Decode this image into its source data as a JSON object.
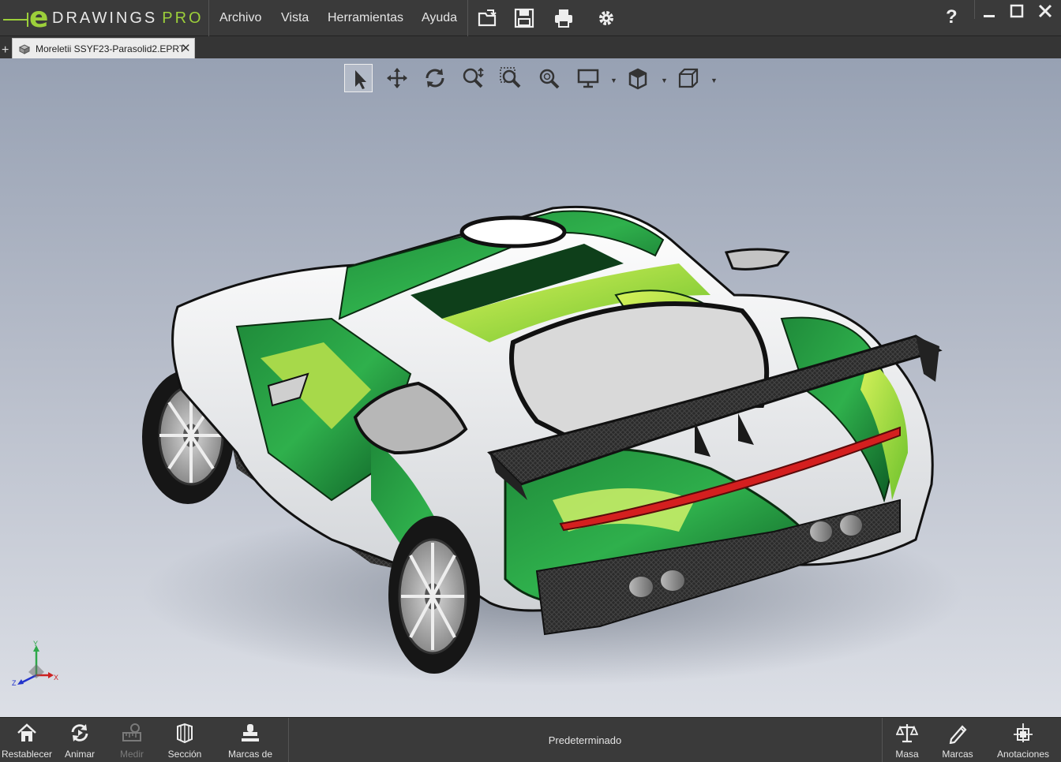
{
  "app": {
    "brand": "DRAWINGS",
    "brand_edition": "PRO",
    "logo_letter": "e"
  },
  "menu": {
    "items": [
      "Archivo",
      "Vista",
      "Herramientas",
      "Ayuda"
    ]
  },
  "toolbar_icons": [
    "open-icon",
    "save-icon",
    "print-icon",
    "settings-icon"
  ],
  "help": "?",
  "tabs": [
    {
      "label": "Moreletii SSYF23-Parasolid2.EPRT",
      "active": true
    }
  ],
  "view_toolbar": {
    "tools": [
      "select-icon",
      "pan-icon",
      "rotate-icon",
      "zoom-to-fit-icon",
      "zoom-to-area-icon",
      "zoom-icon",
      "display-style-icon",
      "view-orientation-icon",
      "standard-views-icon"
    ]
  },
  "triad": {
    "x": "X",
    "y": "Y",
    "z": "Z"
  },
  "bottom_bar": {
    "left_buttons": [
      {
        "label": "Restablecer",
        "icon": "home-icon",
        "enabled": true
      },
      {
        "label": "Animar",
        "icon": "animate-icon",
        "enabled": true
      },
      {
        "label": "Medir",
        "icon": "measure-icon",
        "enabled": false
      },
      {
        "label": "Sección",
        "icon": "section-icon",
        "enabled": true
      },
      {
        "label": "Marcas de",
        "icon": "stamp-icon",
        "enabled": true
      }
    ],
    "configuration": "Predeterminado",
    "right_buttons": [
      {
        "label": "Masa",
        "icon": "scale-icon",
        "enabled": true
      },
      {
        "label": "Marcas",
        "icon": "pen-icon",
        "enabled": true
      },
      {
        "label": "Anotaciones",
        "icon": "annotation-icon",
        "enabled": true
      }
    ]
  },
  "colors": {
    "brand_green": "#9ccf3a",
    "chrome_dark": "#3a3a3a",
    "viewport_top": "#97a1b3",
    "viewport_bottom": "#dcdfe6",
    "livery_green": "#2ea84a",
    "livery_lime": "#a8e03a",
    "taillight_red": "#d41f1f"
  }
}
